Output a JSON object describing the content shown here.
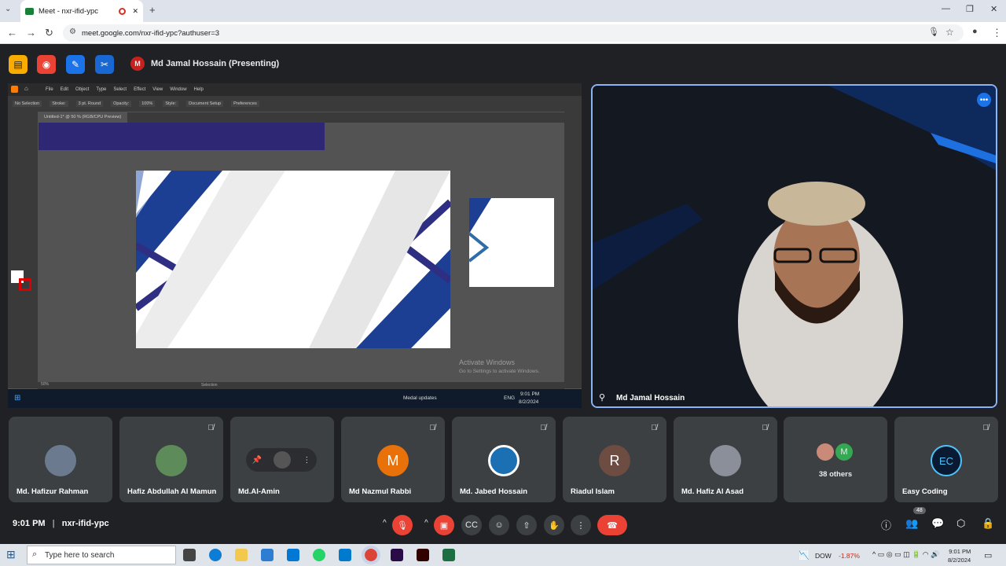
{
  "browser": {
    "tab_title": "Meet - nxr-ifid-ypc",
    "url": "meet.google.com/nxr-ifid-ypc?authuser=3",
    "new_tab": "+",
    "win_min": "—",
    "win_max": "❐",
    "win_close": "✕"
  },
  "meet": {
    "presenter_initial": "M",
    "presenter_label": "Md Jamal Hossain (Presenting)",
    "speaker_name": "Md Jamal Hossain",
    "participants": [
      {
        "name": "Md. Hafizur Rahman",
        "initial": "",
        "color": "#6b7a8f",
        "muted": false
      },
      {
        "name": "Hafiz Abdullah Al Mamun",
        "initial": "",
        "color": "#5e8b5a",
        "muted": true
      },
      {
        "name": "Md.Al-Amin",
        "initial": "",
        "color": "#444",
        "muted": false
      },
      {
        "name": "Md Nazmul Rabbi",
        "initial": "M",
        "color": "#e8710a",
        "muted": true
      },
      {
        "name": "Md. Jabed Hossain",
        "initial": "",
        "color": "#1b6fb3",
        "muted": true
      },
      {
        "name": "Riadul Islam",
        "initial": "R",
        "color": "#6d4c41",
        "muted": true
      },
      {
        "name": "Md. Hafiz Al Asad",
        "initial": "",
        "color": "#8a8f99",
        "muted": true
      },
      {
        "name": "38 others",
        "initial": "M",
        "color": "#34a853",
        "muted": false
      },
      {
        "name": "Easy Coding",
        "initial": "EC",
        "color": "#0b1a33",
        "muted": true
      }
    ],
    "time": "9:01 PM",
    "separator": "|",
    "meeting_code": "nxr-ifid-ypc",
    "people_count": "48"
  },
  "screenshare": {
    "menu": [
      "File",
      "Edit",
      "Object",
      "Type",
      "Select",
      "Effect",
      "View",
      "Window",
      "Help"
    ],
    "ctrl": [
      "No Selection",
      "Stroke:",
      "3 pt. Round",
      "Opacity:",
      "100%",
      "Style:",
      "Document Setup",
      "Preferences"
    ],
    "doc_tab": "Untitled-1* @ 50 % (RGB/CPU Preview)",
    "zoom": "50%",
    "status_tool": "Selection",
    "activate_title": "Activate Windows",
    "activate_sub": "Go to Settings to activate Windows.",
    "inner_taskbar": {
      "medal": "Medal updates",
      "lang": "ENG",
      "time": "9:01 PM",
      "date": "8/2/2024"
    }
  },
  "taskbar": {
    "search_placeholder": "Type here to search",
    "stock_name": "DOW",
    "stock_change": "-1.87%",
    "time": "9:01 PM",
    "date": "8/2/2024"
  },
  "colors": {
    "accent": "#8ab4f8",
    "end_call": "#ea4335",
    "meet_bg": "#202124",
    "tile_bg": "#3c4043"
  }
}
